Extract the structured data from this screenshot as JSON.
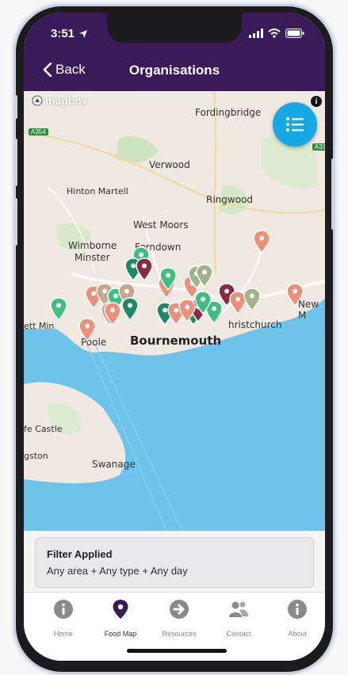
{
  "status_bar": {
    "time": "3:51"
  },
  "header": {
    "back_label": "Back",
    "title": "Organisations"
  },
  "map": {
    "attribution_logo": "mapbox",
    "places": {
      "fordingbridge": "Fordingbridge",
      "verwood": "Verwood",
      "hinton_martell": "Hinton Martell",
      "ringwood": "Ringwood",
      "west_moors": "West Moors",
      "wimborne": "Wimborne",
      "minster": "Minster",
      "ferndown": "Ferndown",
      "new_m": "New M",
      "christchurch": "hristchurch",
      "bournemouth": "Bournemouth",
      "poole": "Poole",
      "ett_min": "ett Min",
      "fe_castle": "fe Castle",
      "gston": "gston",
      "swanage": "Swanage"
    },
    "road_labels": {
      "a354": "A354",
      "a31": "A31"
    },
    "pin_colors": {
      "green": "#3fbf7f",
      "dark_green": "#1f8a6a",
      "salmon": "#ef8f78",
      "maroon": "#8a2a3f",
      "sage": "#9fb48d",
      "tan": "#c9a48e"
    }
  },
  "filter": {
    "title": "Filter Applied",
    "description": "Any area + Any type + Any day"
  },
  "tabs": [
    {
      "label": "Home",
      "icon": "info-icon"
    },
    {
      "label": "Food Map",
      "icon": "map-pin-icon"
    },
    {
      "label": "Resources",
      "icon": "arrow-right-icon"
    },
    {
      "label": "Contact",
      "icon": "people-icon"
    },
    {
      "label": "About",
      "icon": "info-icon"
    }
  ],
  "colors": {
    "header_bg": "#3b1a59",
    "fab_bg": "#17a8e6",
    "sea": "#6ec3ea",
    "land": "#efe9e1",
    "active_tab": "#3b1a59"
  }
}
